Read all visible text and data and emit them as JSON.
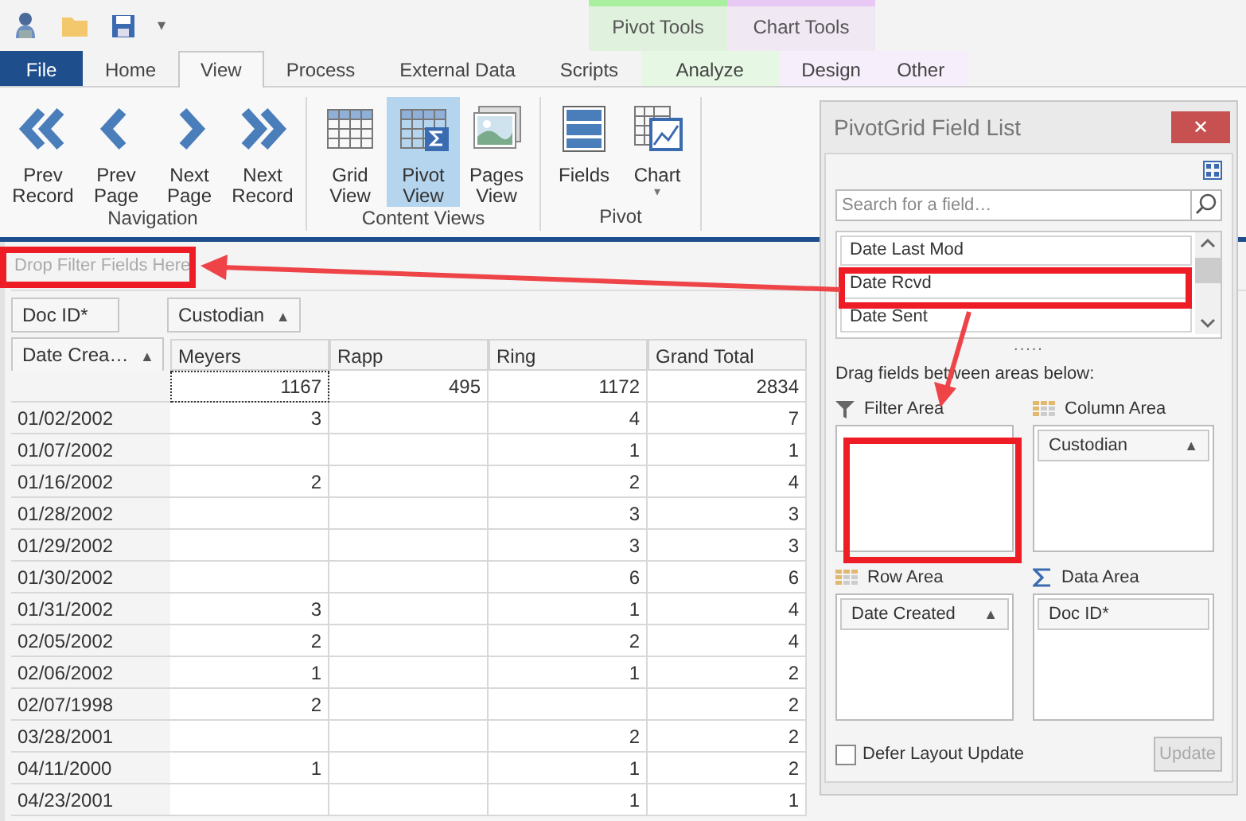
{
  "quick_access": {
    "menu_caret": "▾"
  },
  "context_groups": [
    {
      "label": "Pivot Tools",
      "color": "#a8f0a0"
    },
    {
      "label": "Chart Tools",
      "color": "#e8c8f4"
    }
  ],
  "tabs": [
    {
      "label": "File",
      "kind": "file",
      "selected": false
    },
    {
      "label": "Home",
      "kind": "plain",
      "selected": false
    },
    {
      "label": "View",
      "kind": "plain",
      "selected": true
    },
    {
      "label": "Process",
      "kind": "plain",
      "selected": false
    },
    {
      "label": "External Data",
      "kind": "plain",
      "selected": false
    },
    {
      "label": "Scripts",
      "kind": "plain",
      "selected": false
    },
    {
      "label": "Analyze",
      "kind": "pivot",
      "selected": false
    },
    {
      "label": "Design",
      "kind": "chart",
      "selected": false
    },
    {
      "label": "Other",
      "kind": "chart",
      "selected": false
    }
  ],
  "ribbon_groups": [
    {
      "label": "Navigation",
      "buttons": [
        {
          "label": "Prev Record",
          "selected": false
        },
        {
          "label": "Prev Page",
          "selected": false
        },
        {
          "label": "Next Page",
          "selected": false
        },
        {
          "label": "Next Record",
          "selected": false
        }
      ]
    },
    {
      "label": "Content Views",
      "buttons": [
        {
          "label": "Grid View",
          "selected": false
        },
        {
          "label": "Pivot View",
          "selected": true
        },
        {
          "label": "Pages View",
          "selected": false
        }
      ]
    },
    {
      "label": "Pivot",
      "buttons": [
        {
          "label": "Fields",
          "selected": false
        },
        {
          "label": "Chart",
          "selected": false,
          "dropdown": "▾"
        }
      ]
    }
  ],
  "pivot": {
    "filter_placeholder": "Drop Filter Fields Here",
    "data_fields": [
      {
        "label": "Doc ID*"
      }
    ],
    "column_fields": [
      {
        "label": "Custodian",
        "sort": "▲"
      }
    ],
    "row_field": {
      "label": "Date Crea…",
      "sort": "▲"
    },
    "columns": [
      {
        "label": "Meyers"
      },
      {
        "label": "Rapp"
      },
      {
        "label": "Ring"
      },
      {
        "label": "Grand Total"
      }
    ],
    "totals": [
      "1167",
      "495",
      "1172",
      "2834"
    ],
    "rows": [
      {
        "label": "01/02/2002",
        "meyers": "3",
        "ring": "4",
        "grand_total": "7"
      },
      {
        "label": "01/07/2002",
        "ring": "1",
        "grand_total": "1"
      },
      {
        "label": "01/16/2002",
        "meyers": "2",
        "ring": "2",
        "grand_total": "4"
      },
      {
        "label": "01/28/2002",
        "ring": "3",
        "grand_total": "3"
      },
      {
        "label": "01/29/2002",
        "ring": "3",
        "grand_total": "3"
      },
      {
        "label": "01/30/2002",
        "ring": "6",
        "grand_total": "6"
      },
      {
        "label": "01/31/2002",
        "meyers": "3",
        "ring": "1",
        "grand_total": "4"
      },
      {
        "label": "02/05/2002",
        "meyers": "2",
        "ring": "2",
        "grand_total": "4"
      },
      {
        "label": "02/06/2002",
        "meyers": "1",
        "ring": "1",
        "grand_total": "2"
      },
      {
        "label": "02/07/1998",
        "meyers": "2",
        "grand_total": "2"
      },
      {
        "label": "03/28/2001",
        "ring": "2",
        "grand_total": "2"
      },
      {
        "label": "04/11/2000",
        "meyers": "1",
        "ring": "1",
        "grand_total": "2"
      },
      {
        "label": "04/23/2001",
        "ring": "1",
        "grand_total": "1"
      }
    ]
  },
  "field_list": {
    "title": "PivotGrid Field List",
    "close": "✕",
    "search": {
      "placeholder": "Search for a field…"
    },
    "fields": [
      "Date Last Mod",
      "Date Rcvd",
      "Date Sent"
    ],
    "splitter": ".....",
    "hint": "Drag fields between areas below:",
    "areas": [
      {
        "label": "Filter Area",
        "kind": "filter"
      },
      {
        "label": "Column Area",
        "kind": "column",
        "fields": [
          {
            "label": "Custodian",
            "sort": "▲"
          }
        ]
      },
      {
        "label": "Row Area",
        "kind": "row",
        "fields": [
          {
            "label": "Date Created",
            "sort": "▲"
          }
        ]
      },
      {
        "label": "Data Area",
        "kind": "data",
        "fields": [
          {
            "label": "Doc ID*"
          }
        ]
      }
    ],
    "defer": {
      "label": "Defer Layout Update",
      "checked": false
    },
    "update": {
      "label": "Update",
      "disabled": true
    }
  }
}
